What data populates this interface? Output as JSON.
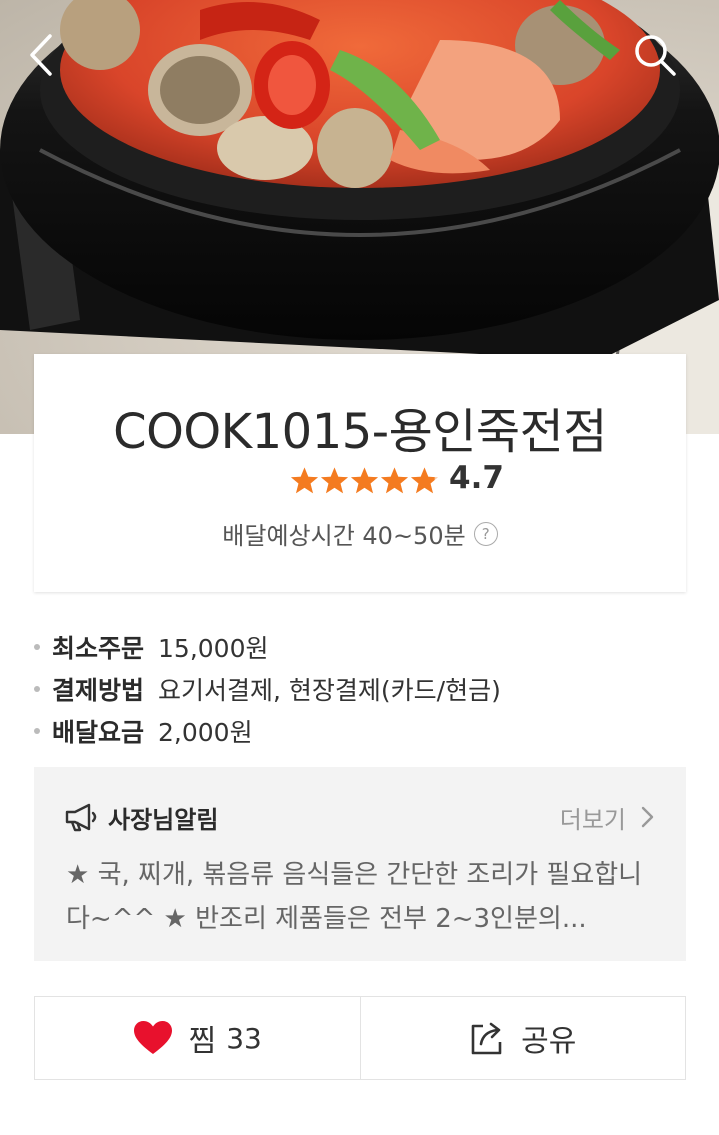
{
  "nav": {
    "back_icon": "back-arrow-icon",
    "search_icon": "search-icon"
  },
  "store": {
    "name": "COOK1015-용인죽전점",
    "rating": "4.7",
    "rating_value": 4.7,
    "rating_max": 5,
    "delivery_time": "배달예상시간 40~50분",
    "help_mark": "?"
  },
  "info": [
    {
      "key": "최소주문",
      "value": "15,000원"
    },
    {
      "key": "결제방법",
      "value": "요기서결제, 현장결제(카드/현금)"
    },
    {
      "key": "배달요금",
      "value": "2,000원"
    }
  ],
  "notice": {
    "title": "사장님알림",
    "more": "더보기",
    "body": "★ 국, 찌개, 볶음류 음식들은 간단한 조리가 필요합니다~^^ ★ 반조리 제품들은 전부 2~3인분의..."
  },
  "actions": {
    "like_label": "찜",
    "like_count": "33",
    "share_label": "공유"
  },
  "colors": {
    "star": "#f47b20",
    "heart": "#e8112d"
  }
}
